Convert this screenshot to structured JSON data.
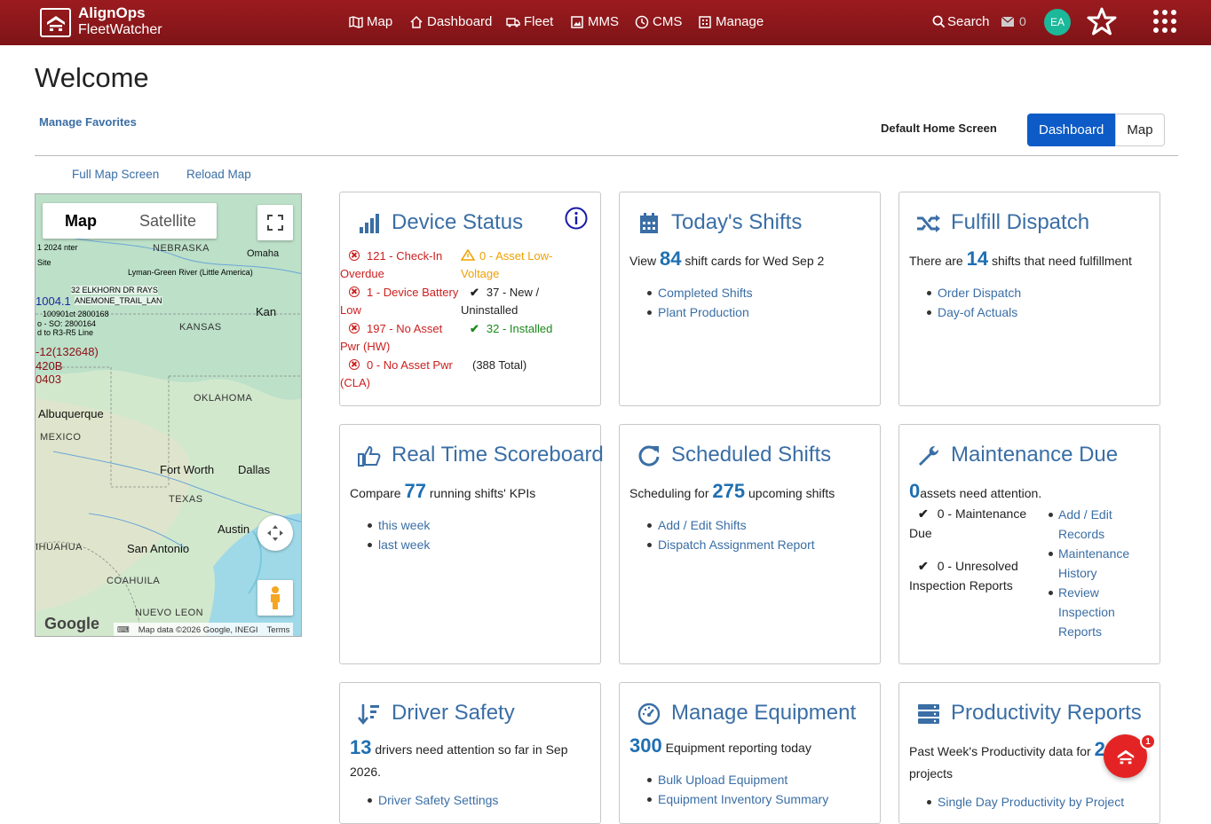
{
  "brand": {
    "line1": "AlignOps",
    "line2": "FleetWatcher"
  },
  "nav": {
    "map": "Map",
    "dashboard": "Dashboard",
    "fleet": "Fleet",
    "mms": "MMS",
    "cms": "CMS",
    "manage": "Manage"
  },
  "header_right": {
    "search": "Search",
    "mail_count": "0",
    "avatar_initials": "EA"
  },
  "welcome": "Welcome",
  "manage_favorites": "Manage Favorites",
  "default_home": {
    "label": "Default Home Screen",
    "dashboard": "Dashboard",
    "map": "Map",
    "selected": "Dashboard"
  },
  "map_links": {
    "full": "Full Map Screen",
    "reload": "Reload Map"
  },
  "map": {
    "tab_map": "Map",
    "tab_satellite": "Satellite",
    "labels": {
      "nebraska": "NEBRASKA",
      "omaha": "Omaha",
      "kansas": "KANSAS",
      "kan": "Kan",
      "oklahoma": "OKLAHOMA",
      "albuquerque": "Albuquerque",
      "mexico": "MEXICO",
      "fort_worth": "Fort Worth",
      "dallas": "Dallas",
      "texas": "TEXAS",
      "austin": "Austin",
      "san_antonio": "San Antonio",
      "chihuahua": "IHUAHUA",
      "coahuila": "COAHUILA",
      "nuevo_leon": "NUEVO LEON",
      "lyman": "Lyman-Green River (Little America)"
    },
    "markers": {
      "r1": "1004.1",
      "r2": "-12(132648)",
      "r3": "420B",
      "r4": "0403"
    },
    "attribution": "Map data ©2026 Google, INEGI",
    "terms": "Terms",
    "google": "Google"
  },
  "cards": {
    "device_status": {
      "title": "Device Status",
      "items": {
        "checkin": "121 - Check-In Overdue",
        "asset_low": "0 - Asset Low-Voltage",
        "battery": "1 - Device Battery Low",
        "new": "37 - New / Uninstalled",
        "no_pwr_hw": "197 - No Asset Pwr (HW)",
        "installed": "32 - Installed",
        "no_pwr_cla": "0 - No Asset Pwr (CLA)",
        "total": "(388 Total)"
      }
    },
    "todays_shifts": {
      "title": "Today's Shifts",
      "prefix": "View",
      "count": "84",
      "suffix": "shift cards for Wed Sep 2",
      "links": [
        "Completed Shifts",
        "Plant Production"
      ]
    },
    "fulfill_dispatch": {
      "title": "Fulfill Dispatch",
      "prefix": "There are",
      "count": "14",
      "suffix": "shifts that need fulfillment",
      "links": [
        "Order Dispatch",
        "Day-of Actuals"
      ]
    },
    "scoreboard": {
      "title": "Real Time Scoreboard",
      "prefix": "Compare",
      "count": "77",
      "suffix": "running shifts' KPIs",
      "links": [
        "this week",
        "last week"
      ]
    },
    "scheduled": {
      "title": "Scheduled Shifts",
      "prefix": "Scheduling for",
      "count": "275",
      "suffix": "upcoming shifts",
      "links": [
        "Add / Edit Shifts",
        "Dispatch Assignment Report"
      ]
    },
    "maintenance": {
      "title": "Maintenance Due",
      "count": "0",
      "suffix": "assets need attention.",
      "status1": "0 - Maintenance Due",
      "status2": "0 - Unresolved Inspection Reports",
      "links": [
        "Add / Edit Records",
        "Maintenance History",
        "Review Inspection Reports"
      ]
    },
    "driver_safety": {
      "title": "Driver Safety",
      "count": "13",
      "suffix": "drivers need attention so far in Sep 2026.",
      "links": [
        "Driver Safety Settings"
      ]
    },
    "manage_equipment": {
      "title": "Manage Equipment",
      "count": "300",
      "suffix": "Equipment reporting today",
      "links": [
        "Bulk Upload Equipment",
        "Equipment Inventory Summary"
      ]
    },
    "productivity": {
      "title": "Productivity Reports",
      "prefix": "Past Week's Productivity data for",
      "count": "2",
      "suffix": "projects",
      "links": [
        "Single Day Productivity by Project"
      ]
    }
  },
  "chat_badge": "1"
}
